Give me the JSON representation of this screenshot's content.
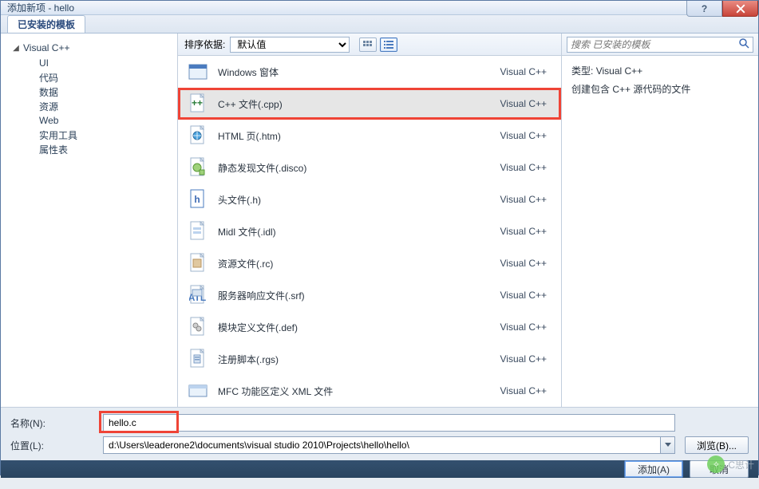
{
  "titlebar": {
    "title": "添加新项 - hello",
    "help": "?",
    "close": "X"
  },
  "tab": {
    "label": "已安装的模板"
  },
  "tree": {
    "root": "Visual C++",
    "children": [
      "UI",
      "代码",
      "数据",
      "资源",
      "Web",
      "实用工具",
      "属性表"
    ]
  },
  "sort": {
    "label": "排序依据:",
    "value": "默认值"
  },
  "search": {
    "placeholder": "搜索 已安装的模板"
  },
  "items": [
    {
      "label": "Windows 窗体",
      "lang": "Visual C++",
      "icon": "form"
    },
    {
      "label": "C++ 文件(.cpp)",
      "lang": "Visual C++",
      "icon": "cpp",
      "selected": true,
      "highlighted": true
    },
    {
      "label": "HTML 页(.htm)",
      "lang": "Visual C++",
      "icon": "html"
    },
    {
      "label": "静态发现文件(.disco)",
      "lang": "Visual C++",
      "icon": "disco"
    },
    {
      "label": "头文件(.h)",
      "lang": "Visual C++",
      "icon": "h"
    },
    {
      "label": "Midl 文件(.idl)",
      "lang": "Visual C++",
      "icon": "idl"
    },
    {
      "label": "资源文件(.rc)",
      "lang": "Visual C++",
      "icon": "rc"
    },
    {
      "label": "服务器响应文件(.srf)",
      "lang": "Visual C++",
      "icon": "srf"
    },
    {
      "label": "模块定义文件(.def)",
      "lang": "Visual C++",
      "icon": "def"
    },
    {
      "label": "注册脚本(.rgs)",
      "lang": "Visual C++",
      "icon": "rgs"
    },
    {
      "label": "MFC 功能区定义 XML 文件",
      "lang": "Visual C++",
      "icon": "xml"
    }
  ],
  "desc": {
    "type_label": "类型:",
    "type_value": "Visual C++",
    "text": "创建包含 C++ 源代码的文件"
  },
  "fields": {
    "name_label": "名称(N):",
    "name_value": "hello.c",
    "loc_label": "位置(L):",
    "loc_value": "d:\\Users\\leaderone2\\documents\\visual studio 2010\\Projects\\hello\\hello\\",
    "browse": "浏览(B)..."
  },
  "actions": {
    "add": "添加(A)",
    "cancel": "取消"
  },
  "watermark": "C思计"
}
